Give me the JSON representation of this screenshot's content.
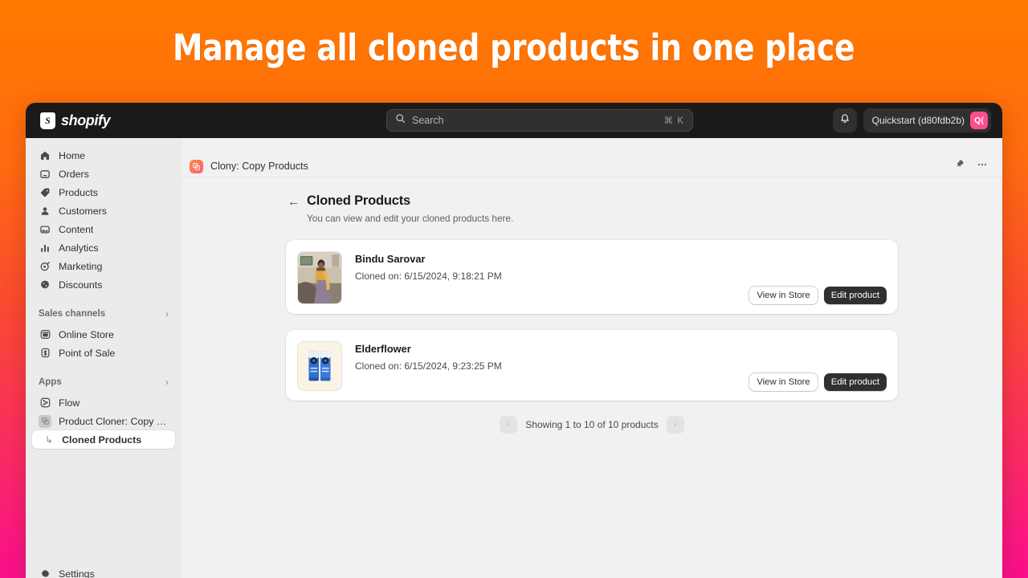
{
  "hero": {
    "title": "Manage all cloned products in one place"
  },
  "topbar": {
    "brand": "shopify",
    "brand_mark": "shopify-bag-icon",
    "search": {
      "placeholder": "Search",
      "shortcut": "⌘ K",
      "icon": "search-icon"
    },
    "notifications_icon": "bell-icon",
    "store_name": "Quickstart (d80fdb2b)",
    "avatar_initials": "Q("
  },
  "sidebar": {
    "items": [
      {
        "label": "Home",
        "icon": "home-icon"
      },
      {
        "label": "Orders",
        "icon": "orders-inbox-icon"
      },
      {
        "label": "Products",
        "icon": "products-tag-icon"
      },
      {
        "label": "Customers",
        "icon": "customers-person-icon"
      },
      {
        "label": "Content",
        "icon": "content-image-icon"
      },
      {
        "label": "Analytics",
        "icon": "analytics-bars-icon"
      },
      {
        "label": "Marketing",
        "icon": "marketing-target-icon"
      },
      {
        "label": "Discounts",
        "icon": "discounts-badge-icon"
      }
    ],
    "sections": [
      {
        "title": "Sales channels",
        "chevron": "›",
        "items": [
          {
            "label": "Online Store",
            "icon": "online-store-icon"
          },
          {
            "label": "Point of Sale",
            "icon": "point-of-sale-icon"
          }
        ]
      },
      {
        "title": "Apps",
        "chevron": "›",
        "items": [
          {
            "label": "Flow",
            "icon": "flow-app-icon"
          },
          {
            "label": "Product Cloner: Copy pro...",
            "icon": "product-cloner-app-icon"
          }
        ]
      }
    ],
    "active_subitem": {
      "label": "Cloned Products",
      "elbow": "↳"
    },
    "bottom_item": {
      "label": "Settings",
      "icon": "settings-gear-icon"
    }
  },
  "app_header": {
    "icon": "clony-app-icon",
    "title": "Clony: Copy Products",
    "pin_icon": "pin-icon",
    "more_icon": "ellipsis-icon"
  },
  "page": {
    "back_arrow": "←",
    "title": "Cloned Products",
    "subtitle": "You can view and edit your cloned products here."
  },
  "products": [
    {
      "name": "Bindu Sarovar",
      "cloned_on": "Cloned on: 6/15/2024, 9:18:21 PM",
      "thumbnail": "woman-in-saree-photo",
      "view_label": "View in Store",
      "edit_label": "Edit product"
    },
    {
      "name": "Elderflower",
      "cloned_on": "Cloned on: 6/15/2024, 9:23:25 PM",
      "thumbnail": "two-blue-cans-photo",
      "view_label": "View in Store",
      "edit_label": "Edit product"
    }
  ],
  "pagination": {
    "prev": "‹",
    "next": "›",
    "info": "Showing 1 to 10 of 10 products"
  },
  "colors": {
    "background_top": "#FF7A00",
    "background_bottom": "#FA0F8C",
    "topbar": "#1a1a1a",
    "sidebar": "#ebebeb",
    "canvas": "#f1f1f1",
    "primary_button": "#303030",
    "avatar": "#FF4D8D"
  }
}
